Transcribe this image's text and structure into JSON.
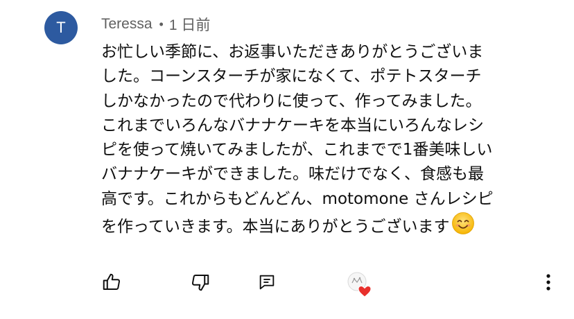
{
  "comment": {
    "avatar_initial": "T",
    "author": "Teressa",
    "separator": "•",
    "timestamp": "1 日前",
    "text_lines": [
      "お忙しい季節に、お返事いただきありがとうございま",
      "した。コーンスターチが家になくて、ポテトスターチ",
      "しかなかったので代わりに使って、作ってみました。",
      "これまでいろんなバナナケーキを本当にいろんなレシ",
      "ピを使って焼いてみましたが、これまでで1番美味しい",
      "バナナケーキができました。味だけでなく、食感も最",
      "高です。これからもどんどん、motomone さんレシピ",
      "を作っていきます。本当にありがとうございます"
    ],
    "trailing_emoji": "smiling-face-emoji"
  },
  "actions": {
    "like_icon": "thumbs-up-icon",
    "dislike_icon": "thumbs-down-icon",
    "reply_icon": "reply-icon",
    "creator_heart_icon": "creator-heart-icon",
    "more_icon": "more-vertical-icon"
  },
  "colors": {
    "avatar_bg": "#2d5aa0",
    "meta_text": "#606060",
    "body_text": "#0f0f0f",
    "heart": "#e8302c"
  }
}
